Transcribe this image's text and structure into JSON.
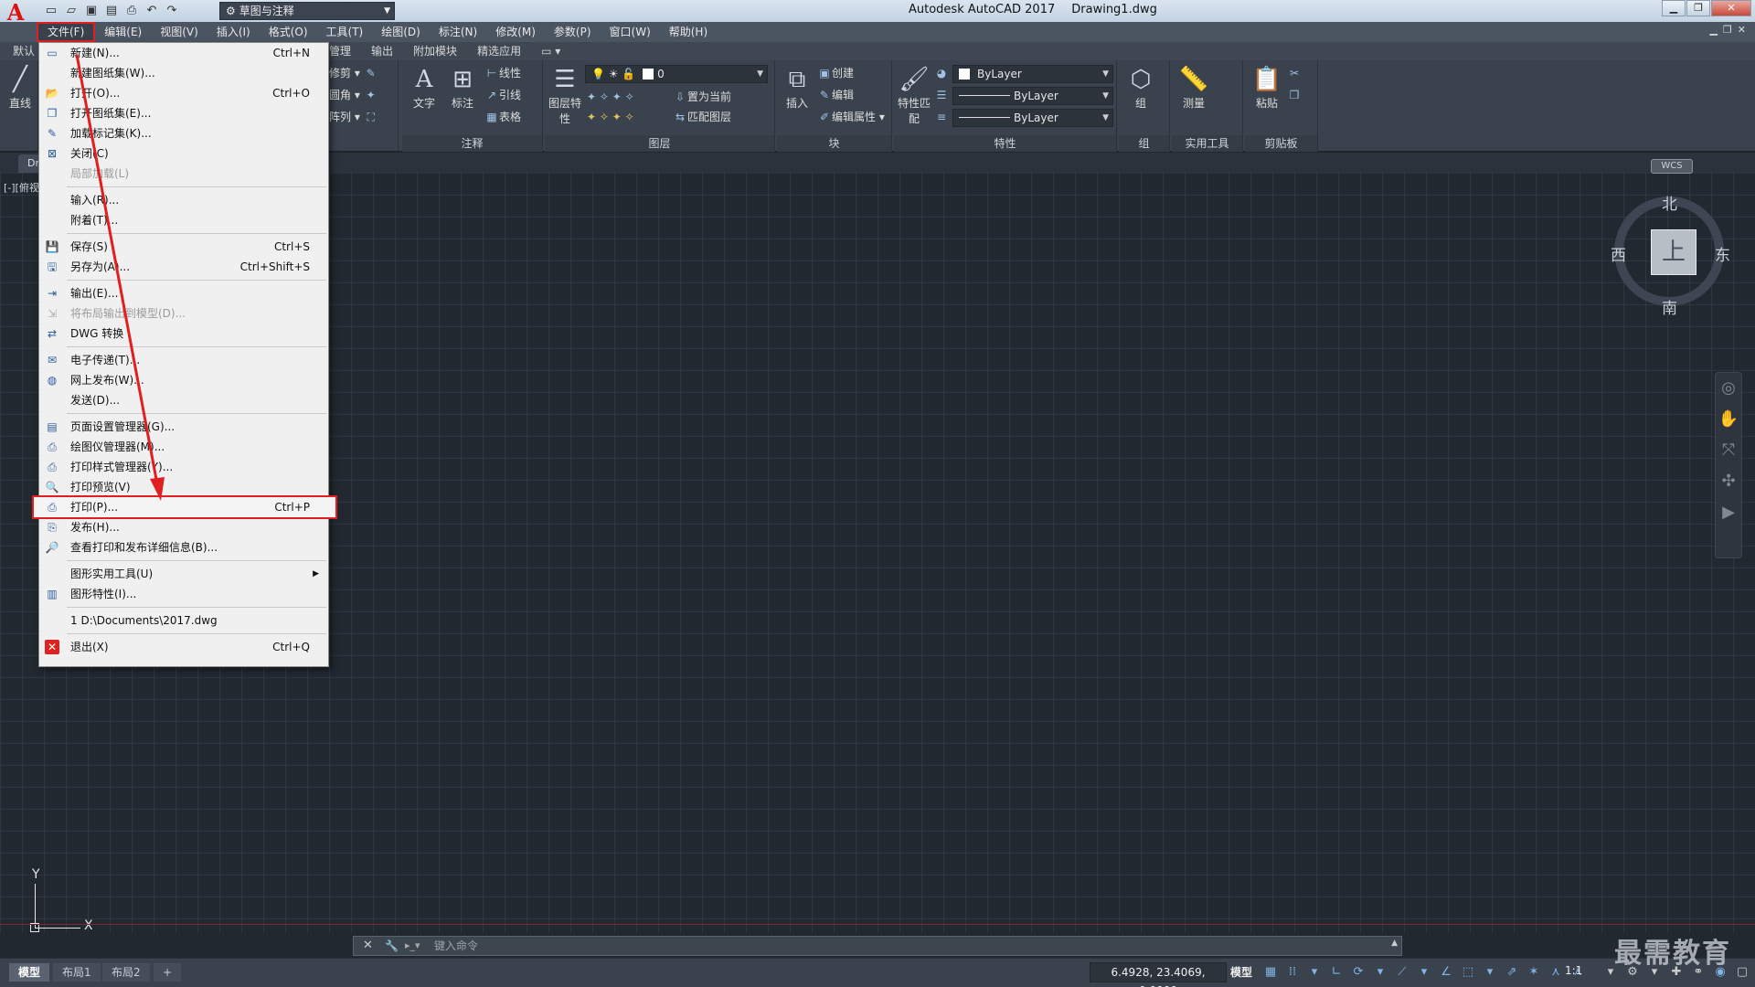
{
  "title_bar": {
    "app_name": "Autodesk AutoCAD 2017",
    "document_name": "Drawing1.dwg",
    "workspace": "草图与注释",
    "logo_letter": "A"
  },
  "menu_bar": {
    "items": [
      "文件(F)",
      "编辑(E)",
      "视图(V)",
      "插入(I)",
      "格式(O)",
      "工具(T)",
      "绘图(D)",
      "标注(N)",
      "修改(M)",
      "参数(P)",
      "窗口(W)",
      "帮助(H)"
    ]
  },
  "ribbon_tabs": [
    "默认",
    "管理",
    "输出",
    "附加模块",
    "精选应用"
  ],
  "ribbon": {
    "draw_line": "直线",
    "modify": [
      "修剪",
      "圆角",
      "阵列"
    ],
    "annotation": {
      "text": "文字",
      "dimension": "标注",
      "linear": "线性",
      "leader": "引线",
      "table": "表格",
      "title": "注释"
    },
    "layers": {
      "properties": "图层特性",
      "current_layer": "0",
      "set_current": "置为当前",
      "match_layer": "匹配图层",
      "title": "图层"
    },
    "block": {
      "insert": "插入",
      "create": "创建",
      "edit": "编辑",
      "edit_attributes": "编辑属性",
      "title": "块"
    },
    "properties": {
      "match": "特性匹配",
      "color": "ByLayer",
      "linetype": "ByLayer",
      "lineweight": "ByLayer",
      "title": "特性"
    },
    "groups": {
      "group": "组",
      "title": "组"
    },
    "utilities": {
      "measure": "测量",
      "title": "实用工具"
    },
    "clipboard": {
      "paste": "粘贴",
      "title": "剪贴板"
    }
  },
  "viewport_label": "[-][俯视]",
  "viewcube": {
    "north": "北",
    "south": "南",
    "east": "东",
    "west": "西",
    "face": "上",
    "wcs": "WCS"
  },
  "ucs": {
    "x": "X",
    "y": "Y"
  },
  "command_line": {
    "placeholder": "键入命令"
  },
  "layout_tabs": [
    "模型",
    "布局1",
    "布局2",
    "+"
  ],
  "status_bar": {
    "coordinates": "6.4928, 23.4069, 0.0000",
    "space": "模型",
    "scale": "1:1"
  },
  "watermark": "最需教育",
  "file_menu": {
    "items": [
      {
        "label": "新建(N)...",
        "shortcut": "Ctrl+N",
        "icon": "new-file-icon",
        "glyph": "▭"
      },
      {
        "label": "新建图纸集(W)...",
        "shortcut": "",
        "icon": "new-sheetset-icon",
        "glyph": ""
      },
      {
        "label": "打开(O)...",
        "shortcut": "Ctrl+O",
        "icon": "open-folder-icon",
        "glyph": "📂"
      },
      {
        "label": "打开图纸集(E)...",
        "shortcut": "",
        "icon": "open-sheetset-icon",
        "glyph": "❐"
      },
      {
        "label": "加载标记集(K)...",
        "shortcut": "",
        "icon": "markup-icon",
        "glyph": "✎"
      },
      {
        "label": "关闭(C)",
        "shortcut": "",
        "icon": "close-file-icon",
        "glyph": "⊠"
      },
      {
        "label": "局部加载(L)",
        "shortcut": "",
        "icon": "",
        "glyph": "",
        "disabled": true
      },
      {
        "sep": true
      },
      {
        "label": "输入(R)...",
        "shortcut": "",
        "icon": "",
        "glyph": ""
      },
      {
        "label": "附着(T)...",
        "shortcut": "",
        "icon": "",
        "glyph": ""
      },
      {
        "sep": true
      },
      {
        "label": "保存(S)",
        "shortcut": "Ctrl+S",
        "icon": "save-icon",
        "glyph": "💾"
      },
      {
        "label": "另存为(A)...",
        "shortcut": "Ctrl+Shift+S",
        "icon": "save-as-icon",
        "glyph": "🖫"
      },
      {
        "sep": true
      },
      {
        "label": "输出(E)...",
        "shortcut": "",
        "icon": "export-icon",
        "glyph": "⇥"
      },
      {
        "label": "将布局输出到模型(D)...",
        "shortcut": "",
        "icon": "export-layout-icon",
        "glyph": "⇲",
        "disabled": true
      },
      {
        "label": "DWG 转换",
        "shortcut": "",
        "icon": "dwg-convert-icon",
        "glyph": "⇄"
      },
      {
        "sep": true
      },
      {
        "label": "电子传递(T)...",
        "shortcut": "",
        "icon": "etransmit-icon",
        "glyph": "✉"
      },
      {
        "label": "网上发布(W)...",
        "shortcut": "",
        "icon": "web-publish-icon",
        "glyph": "◍"
      },
      {
        "label": "发送(D)...",
        "shortcut": "",
        "icon": "",
        "glyph": ""
      },
      {
        "sep": true
      },
      {
        "label": "页面设置管理器(G)...",
        "shortcut": "",
        "icon": "page-setup-icon",
        "glyph": "▤"
      },
      {
        "label": "绘图仪管理器(M)...",
        "shortcut": "",
        "icon": "plotter-icon",
        "glyph": "⎙"
      },
      {
        "label": "打印样式管理器(Y)...",
        "shortcut": "",
        "icon": "plot-style-icon",
        "glyph": "⎙"
      },
      {
        "label": "打印预览(V)",
        "shortcut": "",
        "icon": "plot-preview-icon",
        "glyph": "🔍"
      },
      {
        "label": "打印(P)...",
        "shortcut": "Ctrl+P",
        "icon": "print-icon",
        "glyph": "⎙",
        "highlight": true
      },
      {
        "label": "发布(H)...",
        "shortcut": "",
        "icon": "publish-icon",
        "glyph": "⎘"
      },
      {
        "label": "查看打印和发布详细信息(B)...",
        "shortcut": "",
        "icon": "plot-details-icon",
        "glyph": "🔎"
      },
      {
        "sep": true
      },
      {
        "label": "图形实用工具(U)",
        "shortcut": "",
        "icon": "",
        "glyph": "",
        "submenu": true
      },
      {
        "label": "图形特性(I)...",
        "shortcut": "",
        "icon": "drawing-properties-icon",
        "glyph": "▥"
      },
      {
        "sep": true
      },
      {
        "label": "1 D:\\Documents\\2017.dwg",
        "shortcut": "",
        "icon": "",
        "glyph": "",
        "recent": true
      },
      {
        "sep": true
      },
      {
        "label": "退出(X)",
        "shortcut": "Ctrl+Q",
        "icon": "exit-icon",
        "glyph": "✕",
        "red": true
      }
    ]
  },
  "colors": {
    "highlight_border": "#e02020",
    "canvas_bg": "#212830",
    "ribbon_bg": "#3a424d"
  }
}
